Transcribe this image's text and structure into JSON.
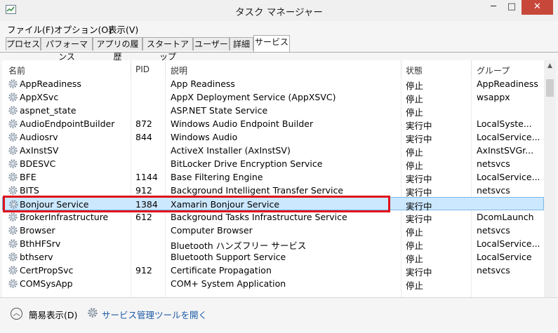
{
  "window": {
    "title": "タスク マネージャー",
    "min": "─",
    "max": "□",
    "close": "✕"
  },
  "menu": [
    "ファイル(F)",
    "オプション(O)",
    "表示(V)"
  ],
  "tabs": [
    "プロセス",
    "パフォーマンス",
    "アプリの履歴",
    "スタートアップ",
    "ユーザー",
    "詳細",
    "サービス"
  ],
  "active_tab": "サービス",
  "columns": [
    "名前",
    "PID",
    "説明",
    "状態",
    "グループ"
  ],
  "sort_indicator": "^",
  "services": [
    {
      "name": "AppReadiness",
      "pid": "",
      "desc": "App Readiness",
      "status": "停止",
      "group": "AppReadiness"
    },
    {
      "name": "AppXSvc",
      "pid": "",
      "desc": "AppX Deployment Service (AppXSVC)",
      "status": "停止",
      "group": "wsappx"
    },
    {
      "name": "aspnet_state",
      "pid": "",
      "desc": "ASP.NET State Service",
      "status": "停止",
      "group": ""
    },
    {
      "name": "AudioEndpointBuilder",
      "pid": "872",
      "desc": "Windows Audio Endpoint Builder",
      "status": "実行中",
      "group": "LocalSyste..."
    },
    {
      "name": "Audiosrv",
      "pid": "844",
      "desc": "Windows Audio",
      "status": "実行中",
      "group": "LocalService..."
    },
    {
      "name": "AxInstSV",
      "pid": "",
      "desc": "ActiveX Installer (AxInstSV)",
      "status": "停止",
      "group": "AxInstSVGr..."
    },
    {
      "name": "BDESVC",
      "pid": "",
      "desc": "BitLocker Drive Encryption Service",
      "status": "停止",
      "group": "netsvcs"
    },
    {
      "name": "BFE",
      "pid": "1144",
      "desc": "Base Filtering Engine",
      "status": "実行中",
      "group": "LocalService..."
    },
    {
      "name": "BITS",
      "pid": "912",
      "desc": "Background Intelligent Transfer Service",
      "status": "実行中",
      "group": "netsvcs"
    },
    {
      "name": "Bonjour Service",
      "pid": "1384",
      "desc": "Xamarin Bonjour Service",
      "status": "実行中",
      "group": "",
      "selected": true
    },
    {
      "name": "BrokerInfrastructure",
      "pid": "612",
      "desc": "Background Tasks Infrastructure Service",
      "status": "実行中",
      "group": "DcomLaunch"
    },
    {
      "name": "Browser",
      "pid": "",
      "desc": "Computer Browser",
      "status": "停止",
      "group": "netsvcs"
    },
    {
      "name": "BthHFSrv",
      "pid": "",
      "desc": "Bluetooth ハンズフリー サービス",
      "status": "停止",
      "group": "LocalService..."
    },
    {
      "name": "bthserv",
      "pid": "",
      "desc": "Bluetooth Support Service",
      "status": "停止",
      "group": "LocalService"
    },
    {
      "name": "CertPropSvc",
      "pid": "912",
      "desc": "Certificate Propagation",
      "status": "実行中",
      "group": "netsvcs"
    },
    {
      "name": "COMSysApp",
      "pid": "",
      "desc": "COM+ System Application",
      "status": "停止",
      "group": ""
    }
  ],
  "footer": {
    "fewer_details": "簡易表示(D)",
    "open_services": "サービス管理ツールを開く"
  },
  "colors": {
    "selection": "#cce8ff",
    "highlight_box": "#e0121b",
    "close_button": "#c7483b",
    "link": "#1c5aa6"
  }
}
